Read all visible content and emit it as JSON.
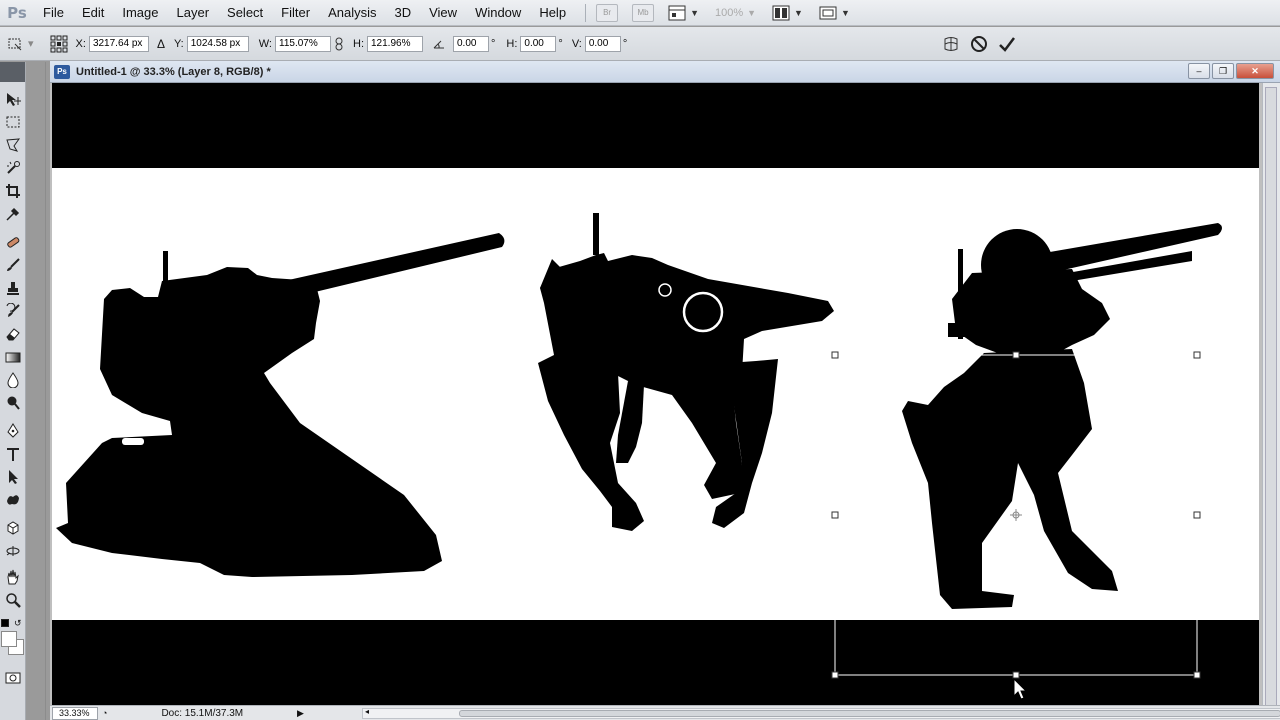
{
  "app": {
    "logo": "Ps",
    "menu": [
      "File",
      "Edit",
      "Image",
      "Layer",
      "Select",
      "Filter",
      "Analysis",
      "3D",
      "View",
      "Window",
      "Help"
    ],
    "bridge_label": "Br",
    "minibridge_label": "Mb",
    "zoom_level": "100%"
  },
  "options": {
    "x_label": "X:",
    "x_value": "3217.64 px",
    "y_label": "Y:",
    "y_value": "1024.58 px",
    "w_label": "W:",
    "w_value": "115.07%",
    "h_label": "H:",
    "h_value": "121.96%",
    "angle_value": "0.00",
    "angle_unit": "°",
    "hskew_label": "H:",
    "hskew_value": "0.00",
    "hskew_unit": "°",
    "vskew_label": "V:",
    "vskew_value": "0.00",
    "vskew_unit": "°"
  },
  "document": {
    "title": "Untitled-1 @ 33.3% (Layer 8, RGB/8) *",
    "ps_badge": "Ps",
    "minimize": "–",
    "restore": "❐",
    "close": "✕"
  },
  "status": {
    "zoom": "33.33%",
    "doc_info": "Doc: 15.1M/37.3M"
  },
  "icons": {
    "move_tool": "move-icon",
    "marquee_tool": "marquee-icon",
    "lasso_tool": "lasso-icon",
    "quick_select_tool": "quick-select-icon",
    "crop_tool": "crop-icon",
    "eyedropper_tool": "eyedropper-icon",
    "healing_tool": "healing-icon",
    "brush_tool": "brush-icon",
    "stamp_tool": "stamp-icon",
    "history_brush_tool": "history-brush-icon",
    "eraser_tool": "eraser-icon",
    "gradient_tool": "gradient-icon",
    "blur_tool": "blur-icon",
    "dodge_tool": "dodge-icon",
    "pen_tool": "pen-icon",
    "type_tool": "type-icon",
    "path_select_tool": "path-select-icon",
    "shape_tool": "shape-icon",
    "3d_rotate_tool": "3d-rotate-icon",
    "3d_orbit_tool": "3d-orbit-icon",
    "hand_tool": "hand-icon",
    "zoom_tool": "zoom-icon"
  }
}
